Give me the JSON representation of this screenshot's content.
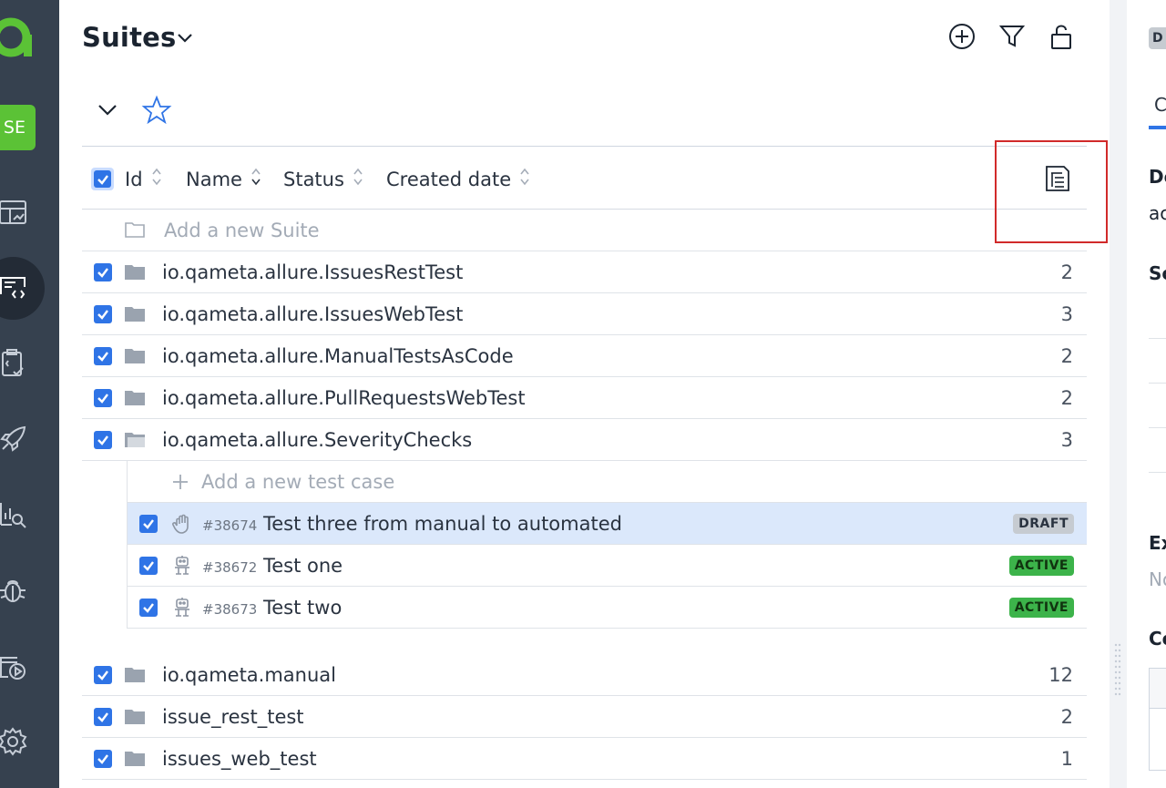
{
  "sidebar": {
    "project_badge": "SE",
    "icons": [
      "logo-icon",
      "dashboard-icon",
      "test-cases-icon",
      "test-plans-icon",
      "launches-icon",
      "analytics-icon",
      "defects-icon",
      "jobs-icon",
      "settings-icon"
    ]
  },
  "header": {
    "title": "Suites",
    "actions": [
      "add-icon",
      "filter-icon",
      "unlock-icon"
    ]
  },
  "columns": {
    "id": "Id",
    "name": "Name",
    "status": "Status",
    "created_date": "Created date"
  },
  "add_suite_label": "Add a new Suite",
  "suites": [
    {
      "name": "io.qameta.allure.IssuesRestTest",
      "count": "2"
    },
    {
      "name": "io.qameta.allure.IssuesWebTest",
      "count": "3"
    },
    {
      "name": "io.qameta.allure.ManualTestsAsCode",
      "count": "2"
    },
    {
      "name": "io.qameta.allure.PullRequestsWebTest",
      "count": "2"
    },
    {
      "name": "io.qameta.allure.SeverityChecks",
      "count": "3"
    },
    {
      "name": "io.qameta.manual",
      "count": "12"
    },
    {
      "name": "issue_rest_test",
      "count": "2"
    },
    {
      "name": "issues_web_test",
      "count": "1"
    }
  ],
  "add_test_case_label": "Add a new test case",
  "test_cases": [
    {
      "id": "#38674",
      "name": "Test three from manual to automated",
      "status": "DRAFT",
      "type": "manual-icon"
    },
    {
      "id": "#38672",
      "name": "Test one",
      "status": "ACTIVE",
      "type": "automated-icon"
    },
    {
      "id": "#38673",
      "name": "Test two",
      "status": "ACTIVE",
      "type": "automated-icon"
    }
  ],
  "right_panel": {
    "badge": "D",
    "tab": "C",
    "section1": "De",
    "section1_value": "ac",
    "section2": "Sc",
    "section3": "Ex",
    "section3_value": "No",
    "section4": "Co"
  },
  "colors": {
    "sidebar": "#36414f",
    "accent": "#2f74e6",
    "active_badge": "#3cb34a",
    "draft_badge": "#c6cbd1",
    "selected_row": "#dbe8fb",
    "highlight": "#d12a2a"
  }
}
